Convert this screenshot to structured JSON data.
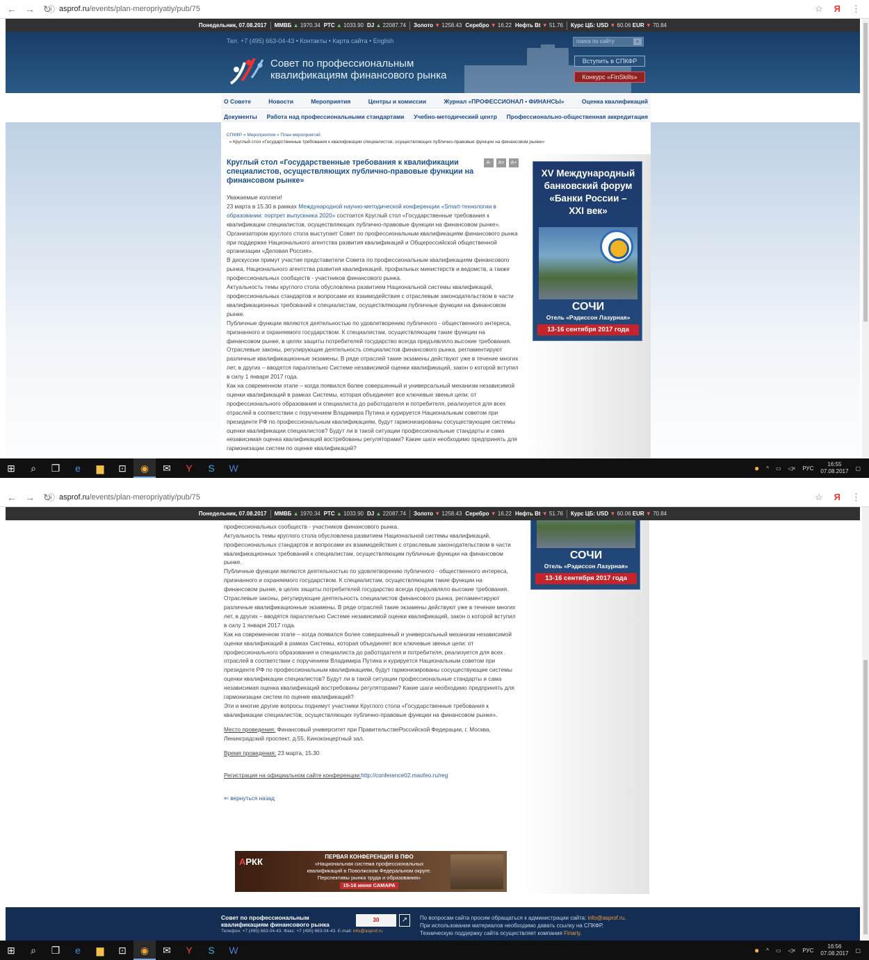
{
  "browser": {
    "url_host": "asprof.ru",
    "url_path": "/events/plan-meropriyatiy/pub/75"
  },
  "ticker": {
    "date": "Понедельник, 07.08.2017",
    "items": [
      {
        "label": "ММВБ",
        "dir": "▲",
        "value": "1970.34"
      },
      {
        "label": "РТС",
        "dir": "▲",
        "value": "1033.90"
      },
      {
        "label": "DJ",
        "dir": "▲",
        "value": "22087.74"
      }
    ],
    "metals": [
      {
        "label": "Золото",
        "dir": "▼",
        "value": "1258.43"
      },
      {
        "label": "Серебро",
        "dir": "▼",
        "value": "16.22"
      },
      {
        "label": "Нефть Bt",
        "dir": "▼",
        "value": "51.76"
      }
    ],
    "cbr_label": "Курс ЦБ: USD",
    "usd_dir": "▼",
    "usd": "60.06",
    "eur_label": "EUR",
    "eur_dir": "▼",
    "eur": "70.84"
  },
  "header": {
    "phone_line": "Тел. +7 (495) 663-04-43 • Контакты • Карта сайта • English",
    "title_line1": "Совет по профессиональным",
    "title_line2": "квалификациям финансового рынка",
    "search_placeholder": "поиск по сайту",
    "join_button": "Вступить в СПКФР",
    "contest_button": "Конкурс «FinSkills»"
  },
  "menu_row1": [
    "О Совете",
    "Новости",
    "Мероприятия",
    "Центры и комиссии",
    "Журнал «ПРОФЕССИОНАЛ • ФИНАНСЫ»",
    "Оценка квалификаций"
  ],
  "menu_row2": [
    "Документы",
    "Работа над профессиональными стандартами",
    "Учебно-методический центр",
    "Профессионально-общественная аккредитация"
  ],
  "breadcrumbs": {
    "a": "СПКФР",
    "b": "Мероприятия",
    "c": "План мероприятий",
    "current": "Круглый стол «Государственные требования к квалификации специалистов, осуществляющих публично-правовые функции на финансовом рынке»"
  },
  "article": {
    "title": "Круглый стол «Государственные требования к квалификации специалистов, осуществляющих публично-правовые функции на финансовом рынке»",
    "font_buttons": [
      "A-",
      "A=",
      "A+"
    ],
    "greeting": "Уважаемые коллеги!",
    "p1_pre": "23 марта в 15.30 в рамках ",
    "p1_link": "Международной научно-методической конференции «Smart-технологии в образовании: портрет выпускника 2020»",
    "p1_post": " состоится Круглый стол «Государственные требования к квалификации специалистов, осуществляющих публично-правовые функции на финансовом рынке».",
    "p2": "Организатором круглого стола выступает Совет по профессиональным квалификациям финансового рынка при поддержке Национального агентства развития квалификаций и Общероссийской общественной организации «Деловая Россия».",
    "p3": "В дискуссии примут участие представители Совета по профессиональным квалификациям финансового рынка, Национального агентства развития квалификаций, профильных министерств и ведомств, а также профессиональных сообществ - участников финансового рынка.",
    "p4": "Актуальность темы круглого стола обусловлена развитием Национальной системы квалификаций, профессиональных стандартов и вопросами их взаимодействия с отраслевым законодательством в части квалификационных требований к специалистам, осуществляющим публичные функции на финансовом рынке.",
    "p5": "Публичные функции являются деятельностью по удовлетворению публичного - общественного интереса, признанного и охраняемого государством. К специалистам, осуществляющим такие функции на финансовом рынке, в целях защиты потребителей государство всегда предъявляло высокие требования. Отраслевые законы, регулирующие деятельность специалистов финансового рынка, регламентируют различные квалификационные экзамены. В ряде отраслей такие экзамены действуют уже в течение многих лет, в других – вводятся параллельно Системе независимой оценки квалификаций, закон о которой вступил в силу 1 января 2017 года.",
    "p6": "Как на современном этапе – когда появился более совершенный и универсальный механизм независимой оценки квалификаций в рамках Системы, которая объединяет все ключевые звенья цепи: от профессионального образования и специалиста до работодателя и потребителя, реализуется для всех отраслей в соответствии с поручением Владимира Путина и курируется Национальным советом при президенте РФ по профессиональным квалификациям, будут гармонизированы сосуществующие системы оценки квалификации специалистов? Будут ли в такой ситуации профессиональные стандарты и сама независимая оценка квалификаций востребованы регуляторами? Какие шаги необходимо предпринять для гармонизации систем по оценке квалификаций?",
    "p7": "Эти и многие другие вопросы поднимут участники Круглого стола «Государственные требования к квалификации специалистов, осуществляющих публично-правовые функции на финансовом рынке».",
    "venue_label": "Место проведения:",
    "venue": " Финансовый университет при ПравительствеРоссийской Федерации, г. Москва, Ленинградский проспект, д.55, Киноконцертный зал.",
    "time_label": "Время проведения:",
    "time": " 23 марта, 15.30",
    "reg_label": "Регистрация на официальном сайте конференции:",
    "reg_link": "http://conference02.maofeo.ru/reg",
    "back": "⇐ вернуться назад"
  },
  "side_banner": {
    "title_l1": "XV Международный",
    "title_l2": "банковский форум",
    "title_l3": "«Банки России –",
    "title_l4": "XXI век»",
    "city": "СОЧИ",
    "hotel": "Отель «Рэдиссон Лазурная»",
    "dates": "13-16 сентября 2017 года"
  },
  "promo_banner": {
    "logo_a": "А",
    "logo_b": "РКК",
    "l1": "ПЕРВАЯ КОНФЕРЕНЦИЯ В ПФО",
    "l2": "«Национальная система профессиональных",
    "l3": "квалификаций в Поволжском Федеральном округе.",
    "l4": "Перспективы рынка труда и образования»",
    "l5": "15-16 июня САМАРА"
  },
  "footer": {
    "org_l1": "Совет по профессиональным",
    "org_l2": "квалификациям финансового рынка",
    "contacts_pre": "Телефон: +7 (495) 663-04-43. Факс: +7 (495) 663-04-43. E-mail: ",
    "contacts_email": "info@asprof.ru",
    "counter": "30",
    "r1_pre": "По вопросам сайта просим обращаться к администрации сайта: ",
    "r1_email": "info@asprof.ru",
    "r1_end": ".",
    "r2": "При использовании материалов необходимо давать ссылку на СПКФР.",
    "r3_pre": "Техническую поддержку сайта осуществляет компания ",
    "r3_company": "Finariy",
    "r3_end": "."
  },
  "taskbar1": {
    "lang": "РУС",
    "time": "16:55",
    "date": "07.08.2017"
  },
  "taskbar2": {
    "lang": "РУС",
    "time": "16:56",
    "date": "07.08.2017"
  }
}
